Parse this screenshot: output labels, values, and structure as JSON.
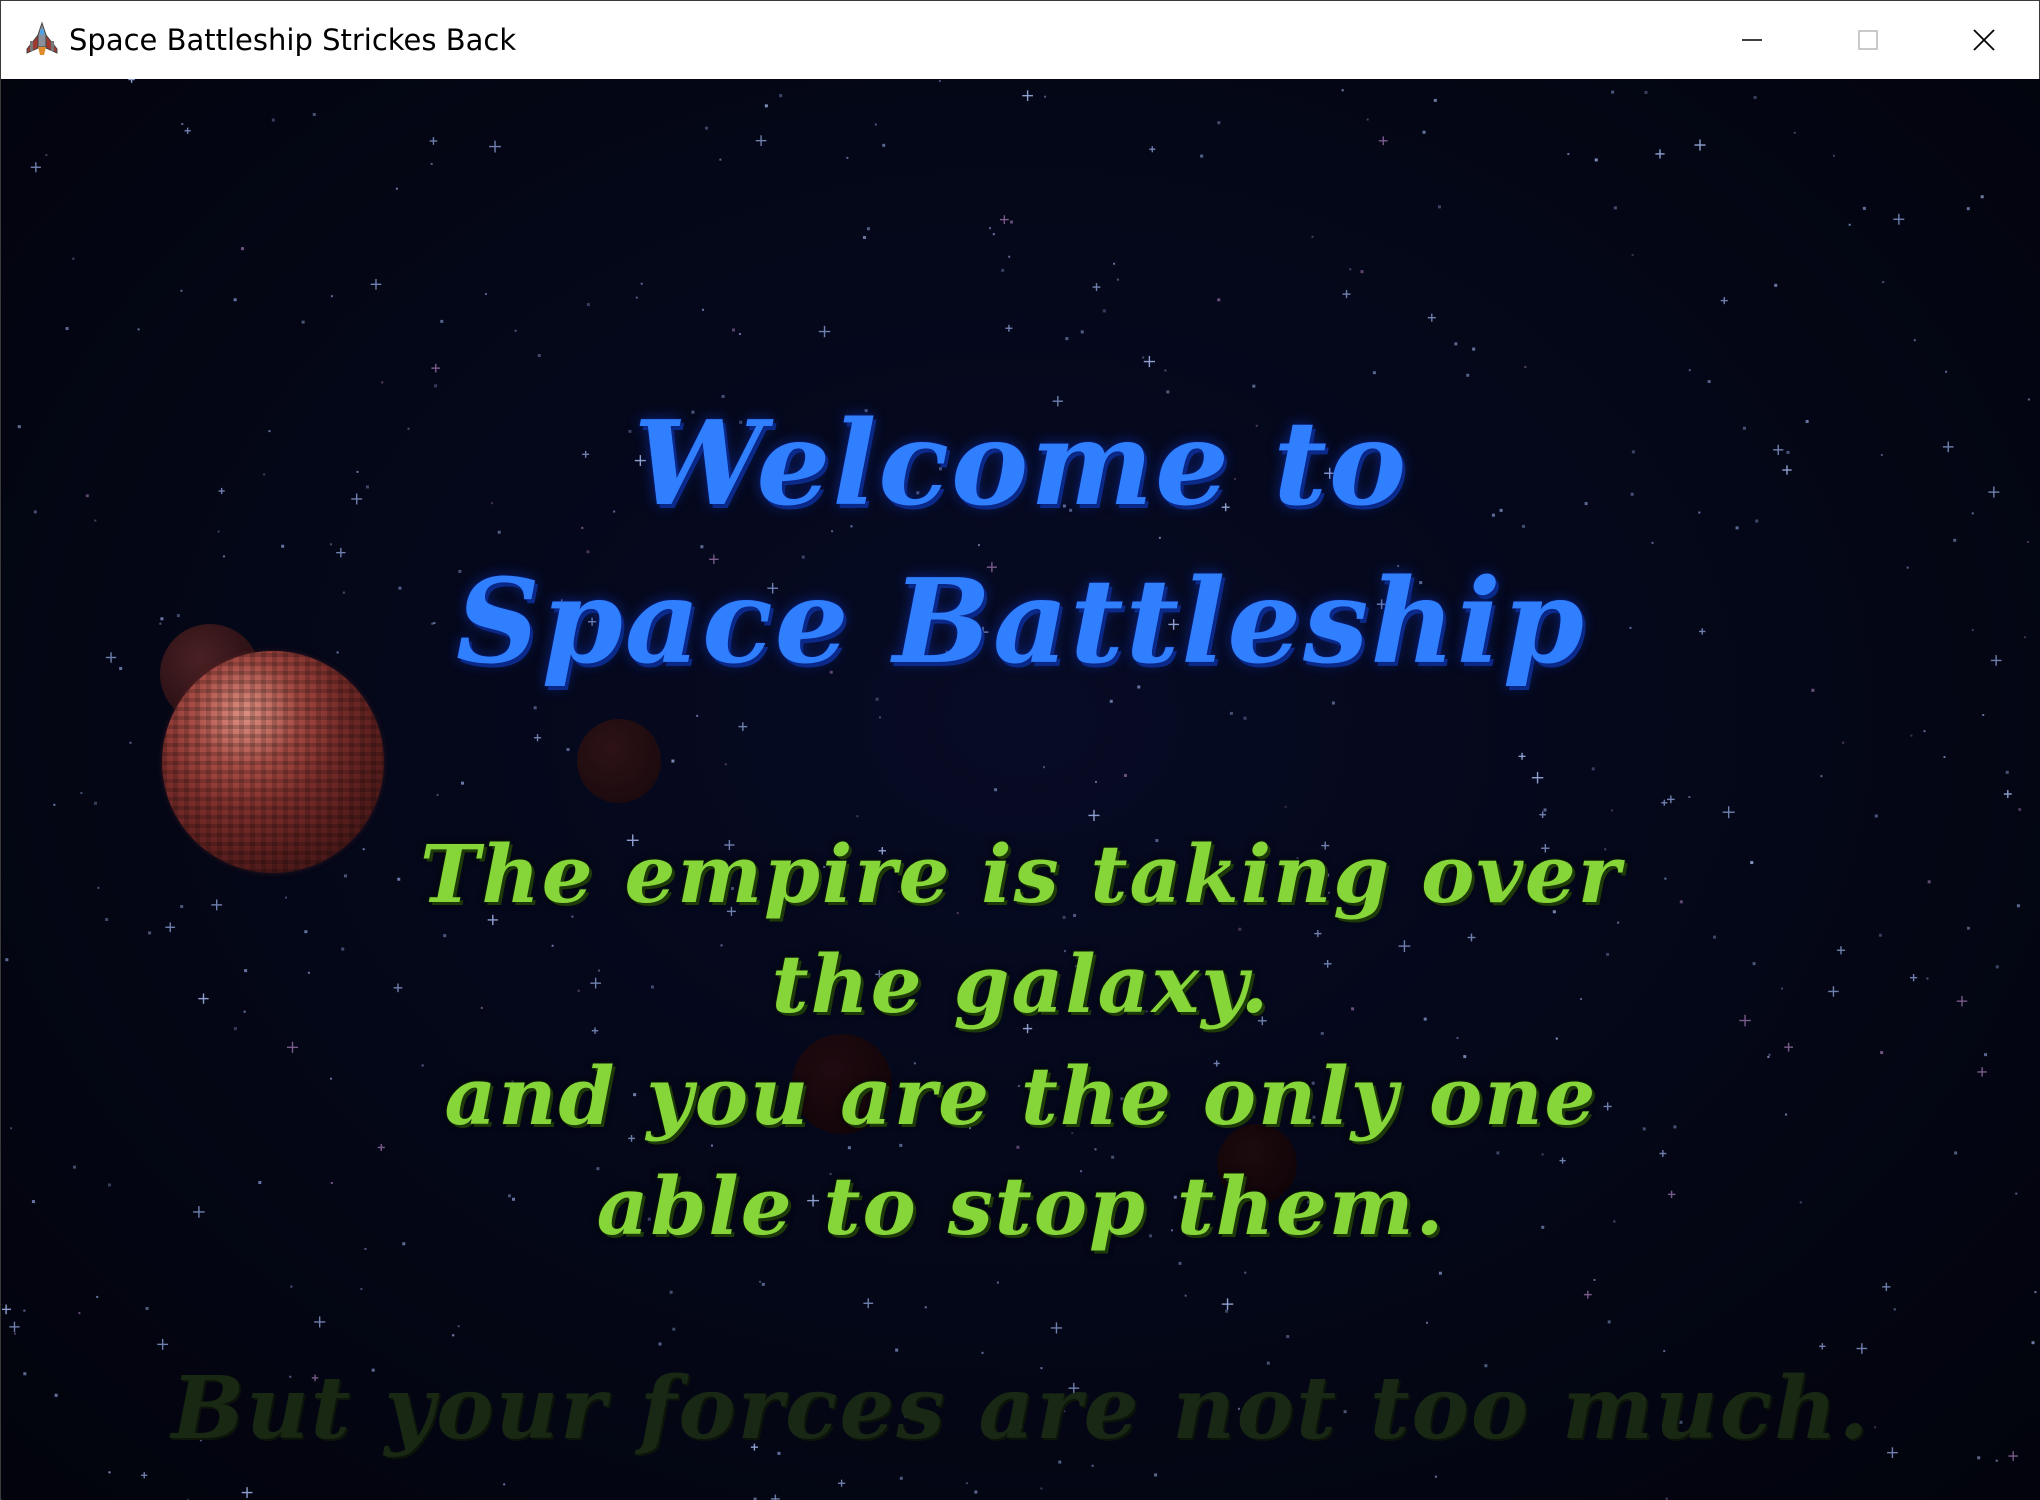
{
  "window": {
    "title": "Space Battleship Strickes Back",
    "icon": "spaceship-icon",
    "controls": {
      "minimize": "minimize-icon",
      "maximize": "maximize-icon",
      "close": "close-icon"
    }
  },
  "intro": {
    "heading_line1": "Welcome to",
    "heading_line2": "Space Battleship",
    "story_line1": "The empire is taking over",
    "story_line2": "the galaxy.",
    "story_line3": "and you are the only one",
    "story_line4": "able to stop them.",
    "fading_line": "But your forces are not too much."
  },
  "colors": {
    "heading": "#2f7fff",
    "story": "#86d63a",
    "background": "#040717",
    "planet": "#8a3531"
  }
}
